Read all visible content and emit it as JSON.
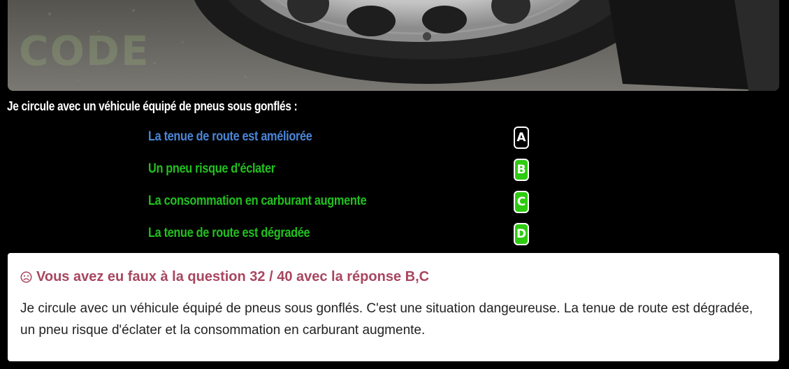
{
  "photo": {
    "watermark_text": "CODE",
    "icon": "tire-photo"
  },
  "question": {
    "text": "Je circule avec un véhicule équipé de pneus sous gonflés :"
  },
  "answers": [
    {
      "text": "La tenue de route est améliorée",
      "key": "A",
      "text_color": "#4a86d8",
      "key_bg": "#000000"
    },
    {
      "text": "Un pneu risque d'éclater",
      "key": "B",
      "text_color": "#22c01f",
      "key_bg": "#2ecb10"
    },
    {
      "text": "La consommation en carburant augmente",
      "key": "C",
      "text_color": "#22c01f",
      "key_bg": "#2ecb10"
    },
    {
      "text": "La tenue de route est dégradée",
      "key": "D",
      "text_color": "#22c01f",
      "key_bg": "#2ecb10"
    }
  ],
  "result": {
    "icon": "sad-face-icon",
    "title": "Vous avez eu faux à la question 32 / 40 avec la réponse B,C",
    "explanation": "Je circule avec un véhicule équipé de pneus sous gonflés. C'est une situation dangeureuse. La tenue de route est dégradée, un pneu risque d'éclater et la consommation en carburant augmente.",
    "title_color": "#a8465f"
  }
}
